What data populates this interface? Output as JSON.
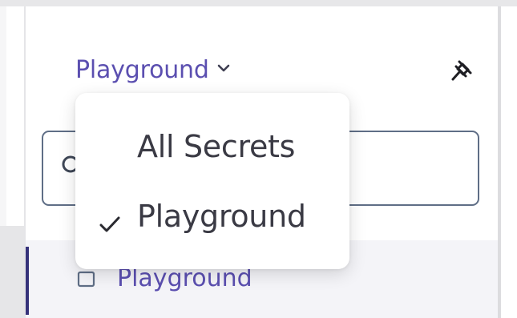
{
  "workspace": {
    "current": "Playground"
  },
  "menu": {
    "options": [
      {
        "label": "All Secrets",
        "selected": false
      },
      {
        "label": "Playground",
        "selected": true
      }
    ]
  },
  "tree": {
    "items": [
      {
        "label": "Playground",
        "active": true
      }
    ]
  },
  "icons": {
    "switcher": "chevron-down-icon",
    "pin": "pin-icon",
    "search": "search-icon",
    "check": "check-icon",
    "item": "folder-icon"
  },
  "colors": {
    "accent": "#5b4fb0",
    "active_bar": "#35327a",
    "menu_text": "#3a3a44"
  }
}
